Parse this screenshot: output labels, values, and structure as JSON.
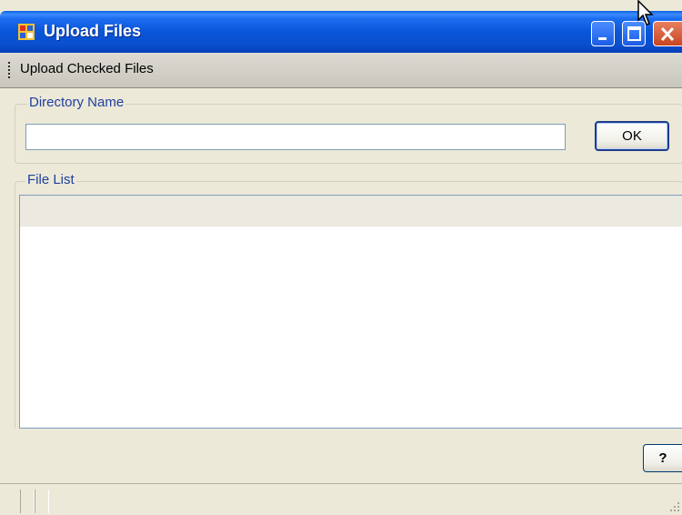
{
  "window": {
    "title": "Upload Files",
    "controls": {
      "minimize": "minimize",
      "maximize": "maximize",
      "close": "close"
    }
  },
  "menu": {
    "items": [
      {
        "label": "Upload Checked Files"
      }
    ]
  },
  "directory_group": {
    "label": "Directory Name",
    "input_value": "",
    "ok_label": "OK"
  },
  "file_list_group": {
    "label": "File List",
    "items": []
  },
  "help_button": {
    "label": "?"
  },
  "colors": {
    "titlebar": "#0a55d8",
    "group_label": "#1f3f9e",
    "window_bg": "#ece9d8"
  },
  "icons": [
    "app-icon",
    "minimize-icon",
    "maximize-icon",
    "close-icon",
    "grip-icon",
    "resize-grip-icon",
    "mouse-cursor-icon"
  ]
}
